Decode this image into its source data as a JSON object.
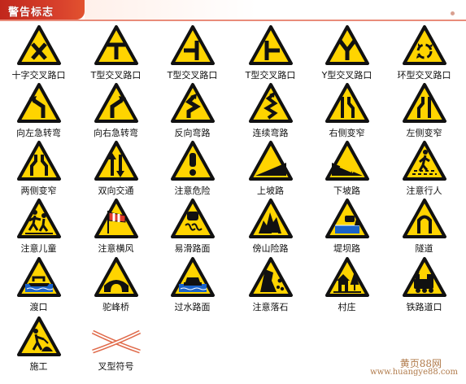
{
  "header": {
    "title": "警告标志"
  },
  "signs": [
    {
      "id": "crossroad",
      "label": "十字交叉路口"
    },
    {
      "id": "t-junction-1",
      "label": "T型交叉路口"
    },
    {
      "id": "t-junction-2",
      "label": "T型交叉路口"
    },
    {
      "id": "t-junction-3",
      "label": "T型交叉路口"
    },
    {
      "id": "y-junction",
      "label": "Y型交叉路口"
    },
    {
      "id": "roundabout",
      "label": "环型交叉路口"
    },
    {
      "id": "sharp-left-curve",
      "label": "向左急转弯"
    },
    {
      "id": "sharp-right-curve",
      "label": "向右急转弯"
    },
    {
      "id": "reverse-curve",
      "label": "反向弯路"
    },
    {
      "id": "winding-road",
      "label": "连续弯路"
    },
    {
      "id": "right-narrow",
      "label": "右侧变窄"
    },
    {
      "id": "left-narrow",
      "label": "左侧变窄"
    },
    {
      "id": "both-narrow",
      "label": "两侧变窄"
    },
    {
      "id": "two-way",
      "label": "双向交通"
    },
    {
      "id": "danger",
      "label": "注意危险"
    },
    {
      "id": "uphill",
      "label": "上坡路"
    },
    {
      "id": "downhill",
      "label": "下坡路"
    },
    {
      "id": "pedestrians",
      "label": "注意行人"
    },
    {
      "id": "children",
      "label": "注意儿童"
    },
    {
      "id": "crosswind",
      "label": "注意横风"
    },
    {
      "id": "slippery",
      "label": "易滑路面"
    },
    {
      "id": "mountain-road",
      "label": "傍山险路"
    },
    {
      "id": "embankment",
      "label": "堤坝路"
    },
    {
      "id": "tunnel",
      "label": "隧道"
    },
    {
      "id": "ferry",
      "label": "渡口"
    },
    {
      "id": "hump-bridge",
      "label": "驼峰桥"
    },
    {
      "id": "ford",
      "label": "过水路面"
    },
    {
      "id": "falling-rocks",
      "label": "注意落石"
    },
    {
      "id": "village",
      "label": "村庄"
    },
    {
      "id": "railway-crossing",
      "label": "铁路道口"
    },
    {
      "id": "road-works",
      "label": "施工"
    },
    {
      "id": "cross-symbol",
      "label": "叉型符号"
    }
  ],
  "watermark": {
    "line1": "黄页88网",
    "line2": "www.huangye88.com"
  },
  "colors": {
    "sign_fill": "#ffd400",
    "sign_border": "#111111",
    "header_red": "#c8281c",
    "cross_red": "#e06a4a"
  }
}
